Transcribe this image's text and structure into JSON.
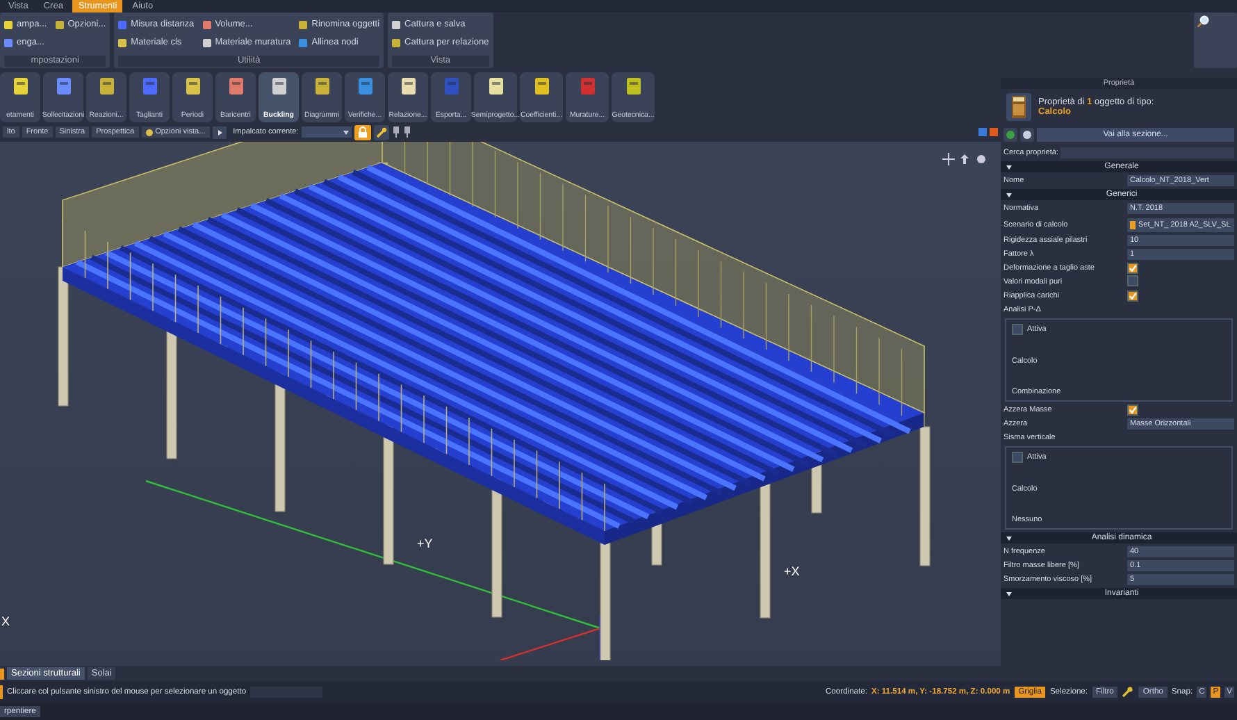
{
  "menu": [
    {
      "label": "Vista",
      "selected": false
    },
    {
      "label": "Crea",
      "selected": false
    },
    {
      "label": "Strumenti",
      "selected": true
    },
    {
      "label": "Aiuto",
      "selected": false
    }
  ],
  "ribbon_groups": [
    {
      "title": "mpostazioni",
      "items": [
        "ampa...",
        "enga...",
        "Opzioni..."
      ]
    },
    {
      "title": "Utilità",
      "items": [
        "Misura distanza",
        "Materiale cls",
        "Volume...",
        "Materiale muratura",
        "Rinomina oggetti",
        "Allinea nodi"
      ]
    },
    {
      "title": "Vista",
      "items": [
        "Cattura e salva",
        "Cattura per relazione"
      ]
    }
  ],
  "tools": [
    {
      "label": "etamenti",
      "selected": false
    },
    {
      "label": "Sollecitazioni",
      "selected": false
    },
    {
      "label": "Reazioni...",
      "selected": false
    },
    {
      "label": "Taglianti",
      "selected": false
    },
    {
      "label": "Periodi",
      "selected": false
    },
    {
      "label": "Baricentri",
      "selected": false
    },
    {
      "label": "Buckling",
      "selected": true
    },
    {
      "label": "Diagrammi",
      "selected": false
    },
    {
      "label": "Verifiche...",
      "selected": false
    },
    {
      "label": "Relazione...",
      "selected": false
    },
    {
      "label": "Esporta...",
      "selected": false
    },
    {
      "label": "Semiprogetto...",
      "selected": false
    },
    {
      "label": "Coefficienti...",
      "selected": false
    },
    {
      "label": "Murature...",
      "selected": false
    },
    {
      "label": "Geotecnica...",
      "selected": false
    }
  ],
  "view_toolbar": {
    "views": [
      "lto",
      "Fronte",
      "Sinistra",
      "Prospettica"
    ],
    "options_button": "Opzioni vista...",
    "floor_label": "Impalcato corrente:"
  },
  "viewport": {
    "axis_labels": [
      "+Y",
      "+X",
      "X"
    ]
  },
  "properties": {
    "title": "Proprietà",
    "object_info": "Proprietà di **1** oggetto di tipo:",
    "object_type": "Calcolo",
    "goto_button": "Vai alla sezione...",
    "search_label": "Cerca proprietà:",
    "rows": [
      {
        "kind": "section",
        "label": "Generale"
      },
      {
        "kind": "field",
        "label": "Nome",
        "value": "Calcolo_NT_2018_Vert"
      },
      {
        "kind": "section",
        "label": "Generici"
      },
      {
        "kind": "field",
        "label": "Normativa",
        "value": "N.T. 2018"
      },
      {
        "kind": "combo",
        "label": "Scenario di calcolo",
        "value": "Set_NT_ 2018 A2_SLV_SL"
      },
      {
        "kind": "field",
        "label": "Rigidezza assiale pilastri",
        "value": "10"
      },
      {
        "kind": "field",
        "label": "Fattore λ",
        "value": "1"
      },
      {
        "kind": "check",
        "label": "Deformazione a taglio aste",
        "checked": true
      },
      {
        "kind": "check",
        "label": "Valori modali puri",
        "checked": false
      },
      {
        "kind": "check",
        "label": "Riapplica carichi",
        "checked": true
      },
      {
        "kind": "label",
        "label": "Analisi P-Δ"
      },
      {
        "kind": "group",
        "check_label": "Attiva",
        "checked": false,
        "lines": [
          "Calcolo",
          "Combinazione"
        ]
      },
      {
        "kind": "check",
        "label": "Azzera Masse",
        "checked": true
      },
      {
        "kind": "field",
        "label": "Azzera",
        "value": "Masse Orizzontali"
      },
      {
        "kind": "label",
        "label": "Sisma verticale"
      },
      {
        "kind": "group",
        "check_label": "Attiva",
        "checked": false,
        "lines": [
          "Calcolo",
          "Nessuno"
        ]
      },
      {
        "kind": "section",
        "label": "Analisi dinamica"
      },
      {
        "kind": "field",
        "label": "N frequenze",
        "value": "40"
      },
      {
        "kind": "field",
        "label": "Filtro masse libere [%]",
        "value": "0.1"
      },
      {
        "kind": "field",
        "label": "Smorzamento viscoso [%]",
        "value": "5"
      },
      {
        "kind": "section",
        "label": "Invarianti"
      }
    ]
  },
  "bottom_tabs": [
    {
      "label": "Sezioni strutturali",
      "selected": true
    },
    {
      "label": "Solai",
      "selected": false
    }
  ],
  "status": {
    "hint": "Cliccare col pulsante sinistro del mouse per selezionare un oggetto",
    "coord_label": "Coordinate:",
    "coords": "X: 11.514 m, Y: -18.752 m, Z: 0.000 m",
    "grid": {
      "label": "Griglia",
      "on": true
    },
    "selection_label": "Selezione:",
    "filter": {
      "label": "Filtro",
      "on": false
    },
    "ortho": {
      "label": "Ortho",
      "on": false
    },
    "snap_label": "Snap:",
    "snap": [
      {
        "label": "C",
        "selected": false
      },
      {
        "label": "P",
        "selected": true
      },
      {
        "label": "V",
        "selected": false
      }
    ]
  },
  "footer_tab": "rpentiere"
}
